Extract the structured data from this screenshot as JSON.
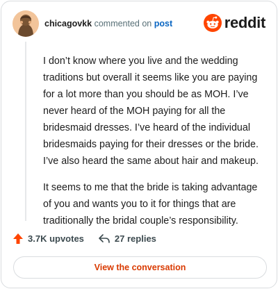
{
  "comment": {
    "username": "chicagovkk",
    "action_text": "commented on",
    "target_link": "post",
    "paragraphs": [
      "I don’t know where you live and the wedding traditions but overall it seems like you are paying for a lot more than you should be as MOH. I’ve never heard of the MOH paying for all the bridesmaid dresses. I’ve heard of the individual bridesmaids paying for their dresses or the bride. I’ve also heard the same about hair and makeup.",
      "It seems to me that the bride is taking advantage of you and wants you to it for things that are traditionally the bridal couple’s responsibility."
    ]
  },
  "brand": {
    "name": "reddit",
    "accent_color": "#ff4500",
    "icon": "reddit-snoo-icon"
  },
  "footer": {
    "upvotes_label": "3.7K upvotes",
    "replies_label": "27 replies",
    "upvote_icon": "upvote-arrow-icon",
    "reply_icon": "reply-arrow-icon",
    "upvote_color": "#ff4500"
  },
  "cta": {
    "label": "View the conversation",
    "color": "#d93a00"
  }
}
